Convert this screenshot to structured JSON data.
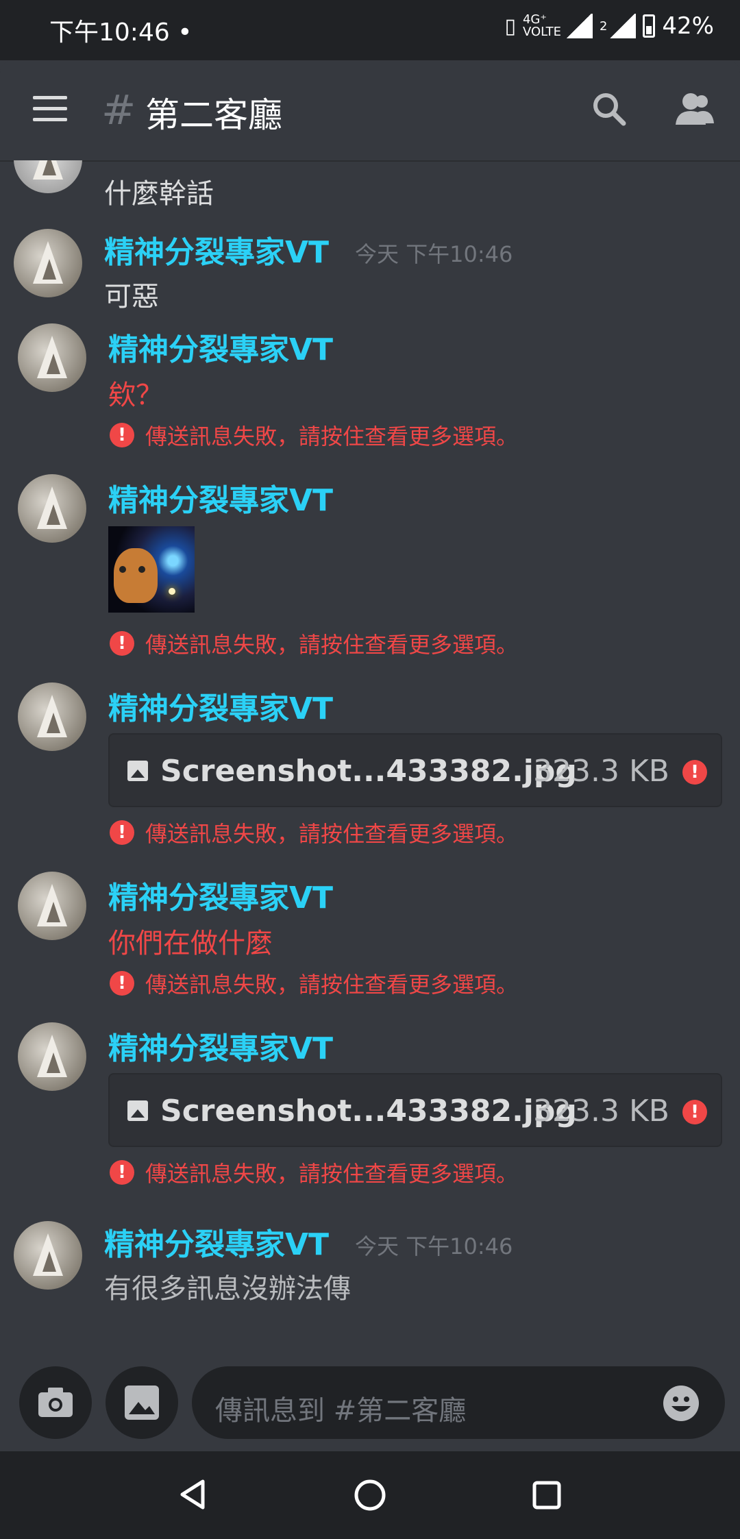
{
  "status_bar": {
    "time": "下午10:46 •",
    "network": "4G⁺ VOLTE",
    "sim2": "2",
    "battery": "42%"
  },
  "header": {
    "hash": "#",
    "title": "第二客廳"
  },
  "messages": [
    {
      "text": "什麼幹話"
    },
    {
      "username": "精神分裂專家VT",
      "timestamp": "今天 下午10:46",
      "text": "可惡"
    },
    {
      "username": "精神分裂專家VT",
      "text": "欸？",
      "error": "傳送訊息失敗，請按住查看更多選項。"
    },
    {
      "username": "精神分裂專家VT",
      "error": "傳送訊息失敗，請按住查看更多選項。"
    },
    {
      "username": "精神分裂專家VT",
      "attachment": {
        "filename": "Screenshot...433382.jpg",
        "size": "323.3 KB"
      },
      "error": "傳送訊息失敗，請按住查看更多選項。"
    },
    {
      "username": "精神分裂專家VT",
      "text": "你們在做什麼",
      "error": "傳送訊息失敗，請按住查看更多選項。"
    },
    {
      "username": "精神分裂專家VT",
      "attachment": {
        "filename": "Screenshot...433382.jpg",
        "size": "323.3 KB"
      },
      "error": "傳送訊息失敗，請按住查看更多選項。"
    },
    {
      "username": "精神分裂專家VT",
      "timestamp": "今天 下午10:46",
      "text": "有很多訊息沒辦法傳"
    }
  ],
  "error_glyph": "!",
  "composer": {
    "placeholder": "傳訊息到 #第二客廳"
  },
  "colors": {
    "background": "#36393f",
    "username": "#2bd1f6",
    "error": "#f04747"
  }
}
